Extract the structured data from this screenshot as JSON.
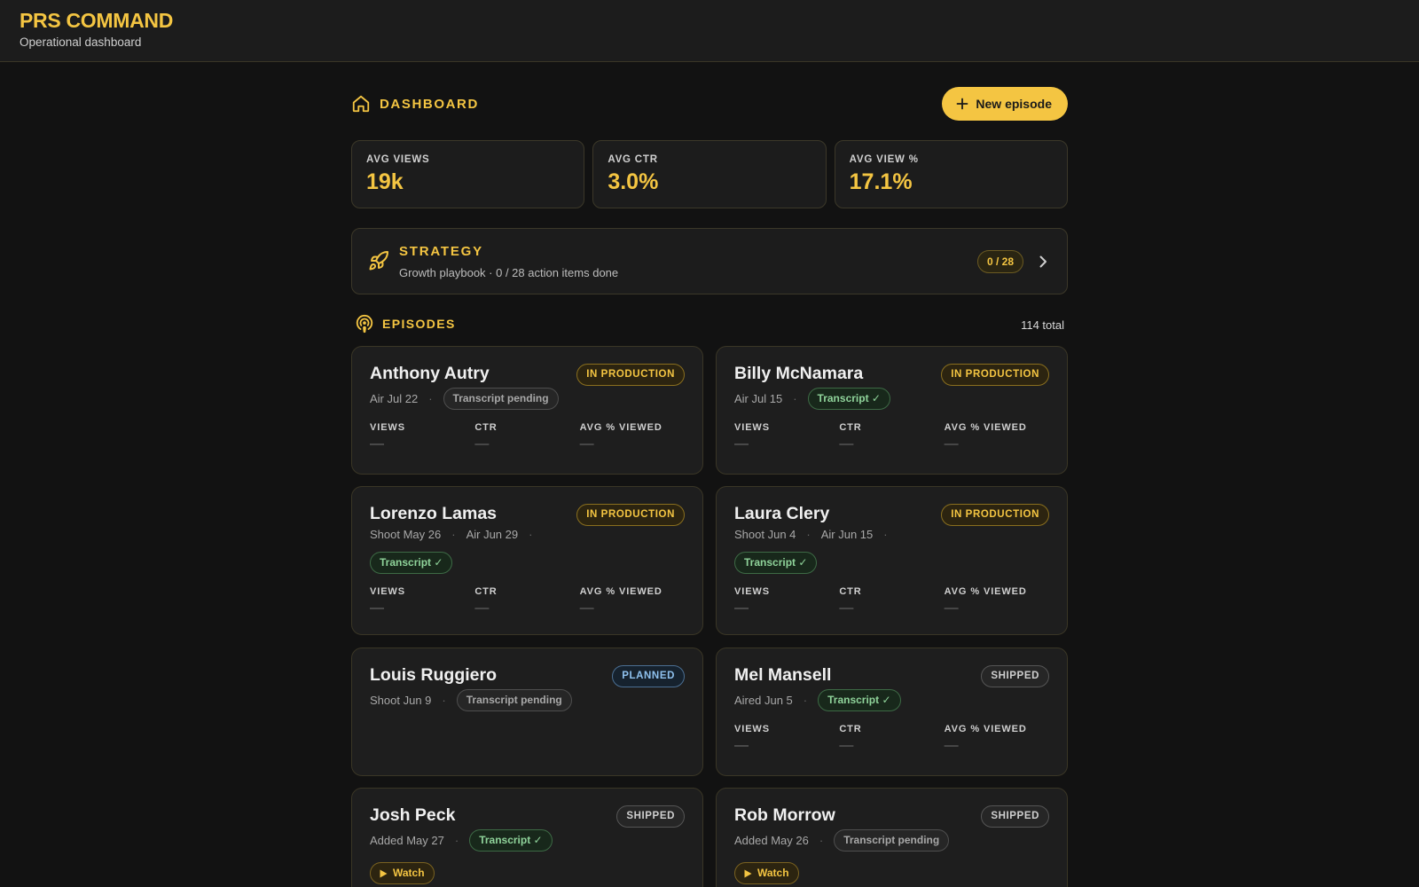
{
  "app": {
    "title": "PRS COMMAND",
    "subtitle": "Operational dashboard"
  },
  "dashboard": {
    "title": "DASHBOARD",
    "new_button": "New episode"
  },
  "stats": [
    {
      "label": "AVG VIEWS",
      "value": "19k"
    },
    {
      "label": "AVG CTR",
      "value": "3.0%"
    },
    {
      "label": "AVG VIEW %",
      "value": "17.1%"
    }
  ],
  "strategy": {
    "title": "STRATEGY",
    "subtitle": "Growth playbook · 0 / 28 action items done",
    "progress": "0 / 28"
  },
  "episodes": {
    "title": "EPISODES",
    "total": "114 total",
    "metric_labels": {
      "views": "VIEWS",
      "ctr": "CTR",
      "avg_viewed": "AVG % VIEWED"
    },
    "empty_value": "—",
    "items": [
      {
        "name": "Anthony Autry",
        "status": "IN PRODUCTION",
        "dates": [
          "Air Jul 22"
        ],
        "transcript": "Transcript pending"
      },
      {
        "name": "Billy McNamara",
        "status": "IN PRODUCTION",
        "dates": [
          "Air Jul 15"
        ],
        "transcript": "Transcript ✓"
      },
      {
        "name": "Lorenzo Lamas",
        "status": "IN PRODUCTION",
        "dates": [
          "Shoot May 26",
          "Air Jun 29"
        ],
        "transcript": "Transcript ✓"
      },
      {
        "name": "Laura Clery",
        "status": "IN PRODUCTION",
        "dates": [
          "Shoot Jun 4",
          "Air Jun 15"
        ],
        "transcript": "Transcript ✓"
      },
      {
        "name": "Louis Ruggiero",
        "status": "PLANNED",
        "dates": [
          "Shoot Jun 9"
        ],
        "transcript": "Transcript pending"
      },
      {
        "name": "Mel Mansell",
        "status": "SHIPPED",
        "dates": [
          "Aired Jun 5"
        ],
        "transcript": "Transcript ✓"
      },
      {
        "name": "Josh Peck",
        "status": "SHIPPED",
        "dates": [
          "Added May 27"
        ],
        "transcript": "Transcript ✓",
        "watch": "Watch"
      },
      {
        "name": "Rob Morrow",
        "status": "SHIPPED",
        "dates": [
          "Added May 26"
        ],
        "transcript": "Transcript pending",
        "watch": "Watch"
      }
    ]
  },
  "colors": {
    "accent": "#f4c542",
    "background": "#121212",
    "card": "#1e1e1e",
    "success": "#8fd39a",
    "info": "#8fc1ee"
  }
}
